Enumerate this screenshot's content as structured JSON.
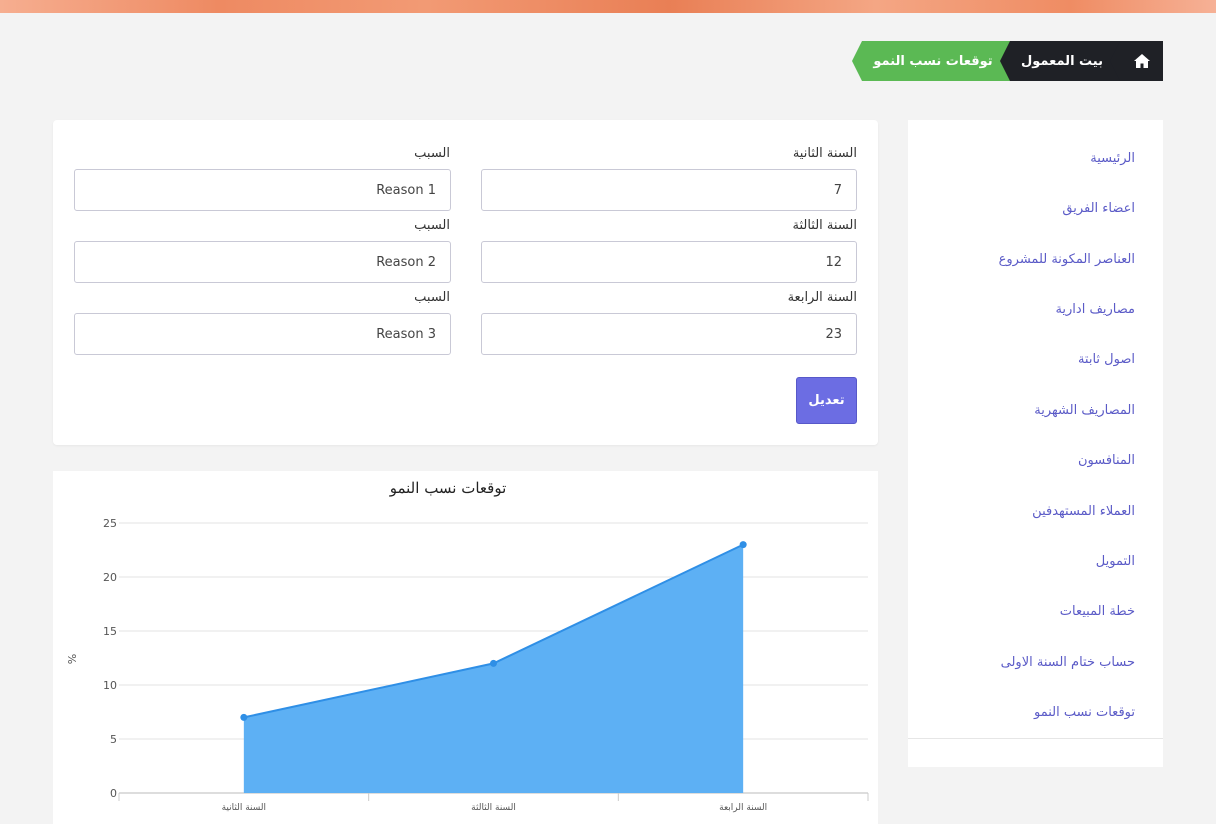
{
  "breadcrumb": {
    "current": "توقعات نسب النمو",
    "parent": "بيت المعمول",
    "home_icon": "home-icon",
    "colors": {
      "current_bg": "#5bb954",
      "dark_bg": "#1f2126"
    }
  },
  "sidebar": {
    "items": [
      {
        "label": "الرئيسية"
      },
      {
        "label": "اعضاء الفريق"
      },
      {
        "label": "العناصر المكونة للمشروع"
      },
      {
        "label": "مصاريف ادارية"
      },
      {
        "label": "اصول ثابتة"
      },
      {
        "label": "المصاريف الشهرية"
      },
      {
        "label": "المنافسون"
      },
      {
        "label": "العملاء المستهدفين"
      },
      {
        "label": "التمويل"
      },
      {
        "label": "خطة المبيعات"
      },
      {
        "label": "حساب ختام السنة الاولى"
      },
      {
        "label": "توقعات نسب النمو"
      }
    ],
    "link_color": "#5b5bc7"
  },
  "form": {
    "rows": [
      {
        "year_label": "السنة الثانية",
        "year_value": "7",
        "reason_label": "السبب",
        "reason_value": "Reason 1"
      },
      {
        "year_label": "السنة الثالثة",
        "year_value": "12",
        "reason_label": "السبب",
        "reason_value": "Reason 2"
      },
      {
        "year_label": "السنة الرابعة",
        "year_value": "23",
        "reason_label": "السبب",
        "reason_value": "Reason 3"
      }
    ],
    "submit_label": "تعديل",
    "submit_color": "#6c6de3"
  },
  "chart_data": {
    "type": "area",
    "title": "توقعات نسب النمو",
    "ylabel": "%",
    "xlabel": "",
    "categories": [
      "السنة الثانية",
      "السنة الثالثة",
      "السنة الرابعة"
    ],
    "values": [
      7,
      12,
      23
    ],
    "ylim": [
      0,
      25
    ],
    "yticks": [
      "0",
      "5",
      "10",
      "15",
      "20",
      "25"
    ],
    "grid": true,
    "fill_color": "#5aaef4",
    "line_color": "#2f8fe6"
  }
}
